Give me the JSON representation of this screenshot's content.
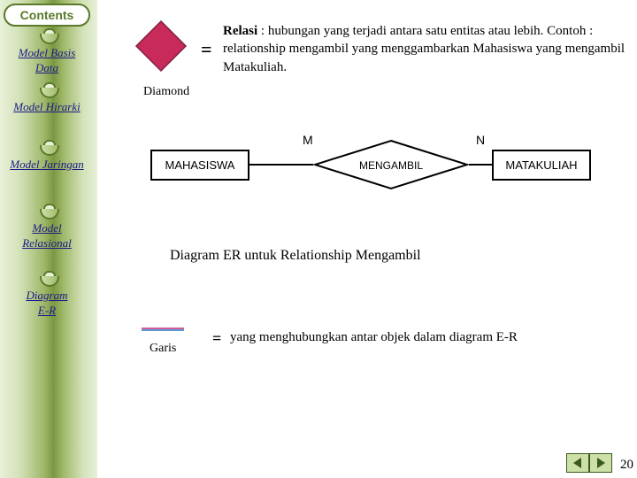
{
  "sidebar": {
    "contents_label": "Contents",
    "items": [
      {
        "label": "Model Basis\nData"
      },
      {
        "label": "Model Hirarki"
      },
      {
        "label": "Model Jaringan"
      },
      {
        "label": "Model\nRelasional"
      },
      {
        "label": "Diagram\nE-R"
      }
    ]
  },
  "relasi": {
    "label_bold": "Relasi",
    "def": " : hubungan yang terjadi antara satu entitas atau lebih. Contoh : relationship mengambil yang menggambarkan Mahasiswa yang mengambil Matakuliah.",
    "shape_label": "Diamond"
  },
  "er": {
    "entity1": "MAHASISWA",
    "relation": "MENGAMBIL",
    "entity2": "MATAKULIAH",
    "card_m": "M",
    "card_n": "N",
    "caption": "Diagram ER untuk Relationship Mengambil"
  },
  "garis": {
    "label": "Garis",
    "def": "yang menghubungkan antar objek dalam diagram E-R"
  },
  "eq": "=",
  "page_number": "20",
  "colors": {
    "diamond_fill": "#c82a5a",
    "diamond_stroke": "#802040"
  }
}
